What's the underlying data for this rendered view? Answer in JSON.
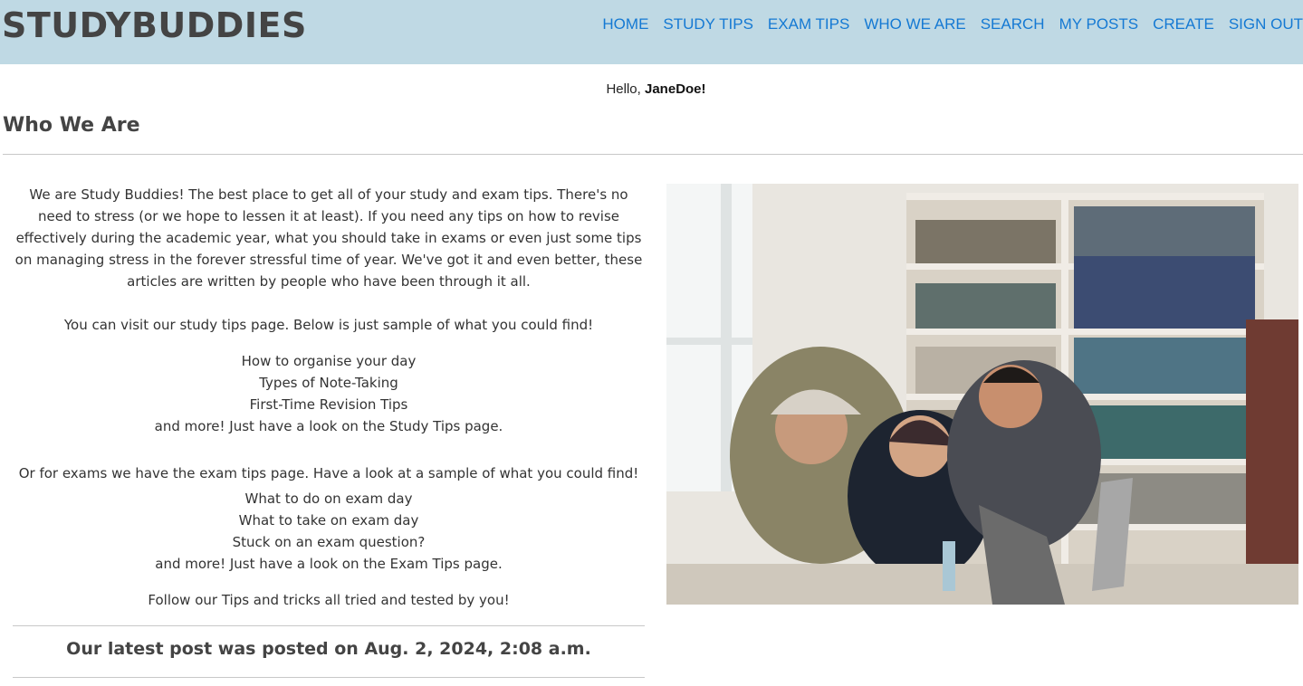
{
  "header": {
    "brand": "STUDYBUDDIES",
    "nav": [
      {
        "label": "HOME"
      },
      {
        "label": "STUDY TIPS"
      },
      {
        "label": "EXAM TIPS"
      },
      {
        "label": "WHO WE ARE"
      },
      {
        "label": "SEARCH"
      },
      {
        "label": "MY POSTS"
      },
      {
        "label": "CREATE"
      },
      {
        "label": "SIGN OUT"
      }
    ]
  },
  "greeting": {
    "prefix": "Hello,",
    "username": "JaneDoe!"
  },
  "page_title": "Who We Are",
  "content": {
    "intro": "We are Study Buddies! The best place to get all of your study and exam tips. There's no need to stress (or we hope to lessen it at least). If you need any tips on how to revise effectively during the academic year, what you should take in exams or even just some tips on managing stress in the forever stressful time of year. We've got it and even better, these articles are written by people who have been through it all.",
    "study_intro": "You can visit our study tips page. Below is just sample of what you could find!",
    "study_items": [
      "How to organise your day",
      "Types of Note-Taking",
      "First-Time Revision Tips",
      "and more! Just have a look on the Study Tips page."
    ],
    "exam_intro": "Or for exams we have the exam tips page. Have a look at a sample of what you could find!",
    "exam_items": [
      "What to do on exam day",
      "What to take on exam day",
      "Stuck on an exam question?",
      "and more! Just have a look on the Exam Tips page."
    ],
    "follow": "Follow our Tips and tricks all tried and tested by you!",
    "latest_post": "Our latest post was posted on Aug. 2, 2024, 2:08 a.m."
  },
  "colors": {
    "header_bg": "#bfd9e4",
    "nav_link": "#1479d3",
    "brand": "#444444"
  }
}
